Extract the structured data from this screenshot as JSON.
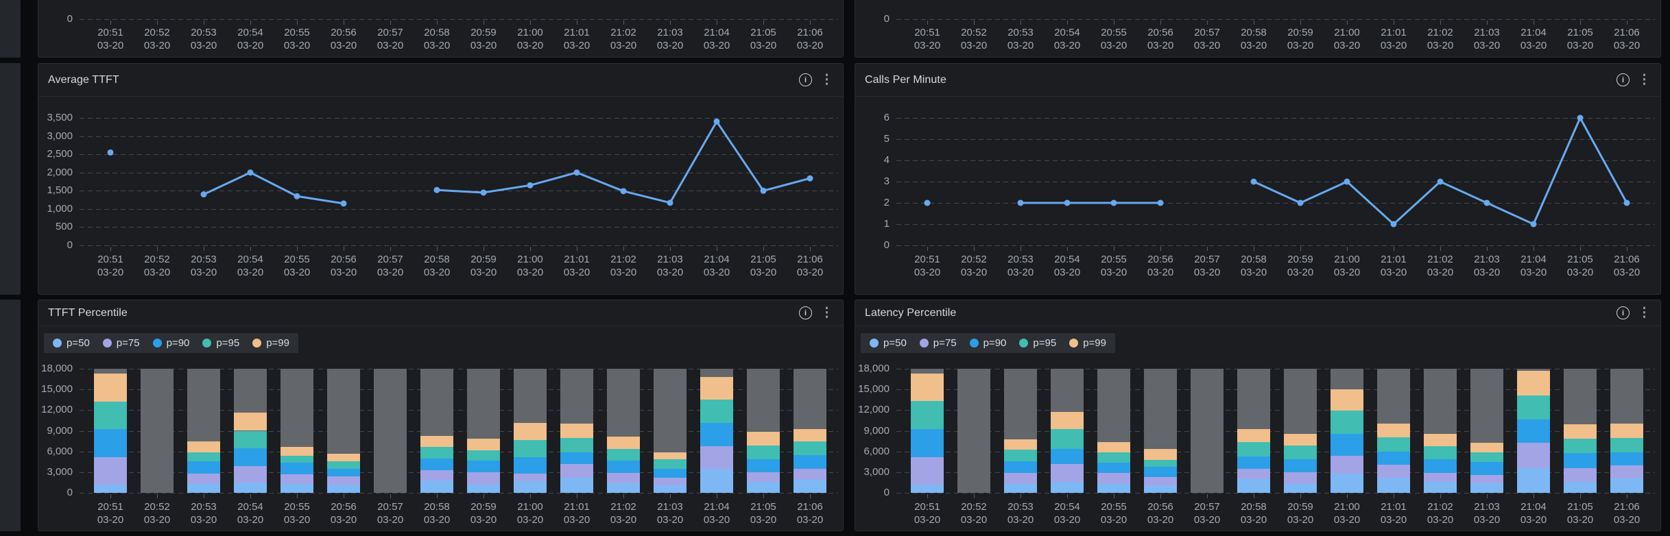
{
  "icons": {
    "info_glyph": "i",
    "kebab_glyph": "⋮"
  },
  "x_axis": {
    "labels": [
      {
        "time": "20:51",
        "date": "03-20"
      },
      {
        "time": "20:52",
        "date": "03-20"
      },
      {
        "time": "20:53",
        "date": "03-20"
      },
      {
        "time": "20:54",
        "date": "03-20"
      },
      {
        "time": "20:55",
        "date": "03-20"
      },
      {
        "time": "20:56",
        "date": "03-20"
      },
      {
        "time": "20:57",
        "date": "03-20"
      },
      {
        "time": "20:58",
        "date": "03-20"
      },
      {
        "time": "20:59",
        "date": "03-20"
      },
      {
        "time": "21:00",
        "date": "03-20"
      },
      {
        "time": "21:01",
        "date": "03-20"
      },
      {
        "time": "21:02",
        "date": "03-20"
      },
      {
        "time": "21:03",
        "date": "03-20"
      },
      {
        "time": "21:04",
        "date": "03-20"
      },
      {
        "time": "21:05",
        "date": "03-20"
      },
      {
        "time": "21:06",
        "date": "03-20"
      }
    ]
  },
  "chart_data": [
    {
      "type": "axis",
      "note": "cut-off panel, only x-axis visible",
      "y_ticks": [
        {
          "v": 0,
          "label": "0"
        }
      ]
    },
    {
      "type": "axis",
      "note": "cut-off panel, only x-axis visible",
      "y_ticks": [
        {
          "v": 0,
          "label": "0"
        }
      ]
    },
    {
      "type": "line",
      "title": "Average TTFT",
      "color": "#68a9ef",
      "y_max": 3500,
      "y_ticks": [
        {
          "v": 0,
          "label": "0"
        },
        {
          "v": 500,
          "label": "500"
        },
        {
          "v": 1000,
          "label": "1,000"
        },
        {
          "v": 1500,
          "label": "1,500"
        },
        {
          "v": 2000,
          "label": "2,000"
        },
        {
          "v": 2500,
          "label": "2,500"
        },
        {
          "v": 3000,
          "label": "3,000"
        },
        {
          "v": 3500,
          "label": "3,500"
        }
      ],
      "values": [
        2550,
        null,
        1400,
        2000,
        1350,
        1150,
        null,
        1520,
        1450,
        1650,
        2000,
        1490,
        1170,
        3400,
        1500,
        1840
      ]
    },
    {
      "type": "line",
      "title": "Calls Per Minute",
      "color": "#68a9ef",
      "y_max": 6,
      "y_ticks": [
        {
          "v": 0,
          "label": "0"
        },
        {
          "v": 1,
          "label": "1"
        },
        {
          "v": 2,
          "label": "2"
        },
        {
          "v": 3,
          "label": "3"
        },
        {
          "v": 4,
          "label": "4"
        },
        {
          "v": 5,
          "label": "5"
        },
        {
          "v": 6,
          "label": "6"
        }
      ],
      "values": [
        2,
        null,
        2,
        2,
        2,
        2,
        null,
        3,
        2,
        3,
        1,
        3,
        2,
        1,
        6,
        2
      ]
    },
    {
      "type": "stacked",
      "title": "TTFT Percentile",
      "y_max": 18000,
      "background_top": 18000,
      "background_color": "#63666b",
      "y_ticks": [
        {
          "v": 0,
          "label": "0"
        },
        {
          "v": 3000,
          "label": "3,000"
        },
        {
          "v": 6000,
          "label": "6,000"
        },
        {
          "v": 9000,
          "label": "9,000"
        },
        {
          "v": 12000,
          "label": "12,000"
        },
        {
          "v": 15000,
          "label": "15,000"
        },
        {
          "v": 18000,
          "label": "18,000"
        }
      ],
      "series": [
        {
          "name": "p50",
          "label": "p=50",
          "color": "#7db8f5",
          "cumulative": [
            1150,
            null,
            1250,
            1490,
            1320,
            1160,
            null,
            1800,
            1230,
            1650,
            2150,
            1400,
            1100,
            3500,
            1550,
            1900
          ]
        },
        {
          "name": "p75",
          "label": "p=75",
          "color": "#a3a4e6",
          "cumulative": [
            5150,
            null,
            2800,
            3900,
            2700,
            2400,
            null,
            3300,
            3000,
            2800,
            4150,
            2850,
            2150,
            6750,
            3000,
            3500
          ]
        },
        {
          "name": "p90",
          "label": "p=90",
          "color": "#2b9fe8",
          "cumulative": [
            9250,
            null,
            4550,
            6450,
            4350,
            3500,
            null,
            5000,
            4650,
            5150,
            5850,
            4650,
            3500,
            10150,
            4850,
            5500
          ]
        },
        {
          "name": "p95",
          "label": "p=95",
          "color": "#41bdb2",
          "cumulative": [
            13200,
            null,
            5900,
            9000,
            5400,
            4600,
            null,
            6700,
            6150,
            7650,
            8000,
            6350,
            4850,
            13500,
            6900,
            7450
          ]
        },
        {
          "name": "p99",
          "label": "p=99",
          "color": "#f0bf8b",
          "cumulative": [
            17300,
            null,
            7450,
            11600,
            6700,
            5700,
            null,
            8300,
            7850,
            10150,
            10000,
            8150,
            5900,
            16850,
            8850,
            9250
          ]
        }
      ]
    },
    {
      "type": "stacked",
      "title": "Latency Percentile",
      "y_max": 18000,
      "background_top": 18000,
      "background_color": "#63666b",
      "y_ticks": [
        {
          "v": 0,
          "label": "0"
        },
        {
          "v": 3000,
          "label": "3,000"
        },
        {
          "v": 6000,
          "label": "6,000"
        },
        {
          "v": 9000,
          "label": "9,000"
        },
        {
          "v": 12000,
          "label": "12,000"
        },
        {
          "v": 15000,
          "label": "15,000"
        },
        {
          "v": 18000,
          "label": "18,000"
        }
      ],
      "series": [
        {
          "name": "p50",
          "label": "p=50",
          "color": "#7db8f5",
          "cumulative": [
            1160,
            null,
            1260,
            1590,
            1330,
            1100,
            null,
            1950,
            1300,
            2830,
            2170,
            1630,
            1400,
            3570,
            1630,
            2070
          ]
        },
        {
          "name": "p75",
          "label": "p=75",
          "color": "#a3a4e6",
          "cumulative": [
            5170,
            null,
            2850,
            4140,
            2900,
            2320,
            null,
            3510,
            2970,
            5400,
            4070,
            2900,
            2630,
            7300,
            3570,
            3970
          ]
        },
        {
          "name": "p90",
          "label": "p=90",
          "color": "#2b9fe8",
          "cumulative": [
            9210,
            null,
            4570,
            6400,
            4400,
            3740,
            null,
            5240,
            4900,
            8570,
            5970,
            4900,
            4500,
            10630,
            5730,
            5900
          ]
        },
        {
          "name": "p95",
          "label": "p=95",
          "color": "#41bdb2",
          "cumulative": [
            13290,
            null,
            6230,
            9210,
            5900,
            4740,
            null,
            7330,
            6830,
            11900,
            8070,
            6800,
            5900,
            14170,
            7900,
            7970
          ]
        },
        {
          "name": "p99",
          "label": "p=99",
          "color": "#f0bf8b",
          "cumulative": [
            17340,
            null,
            7790,
            11700,
            7400,
            6400,
            null,
            9210,
            8570,
            15000,
            10070,
            8570,
            7300,
            17730,
            9900,
            10000
          ]
        }
      ]
    }
  ]
}
